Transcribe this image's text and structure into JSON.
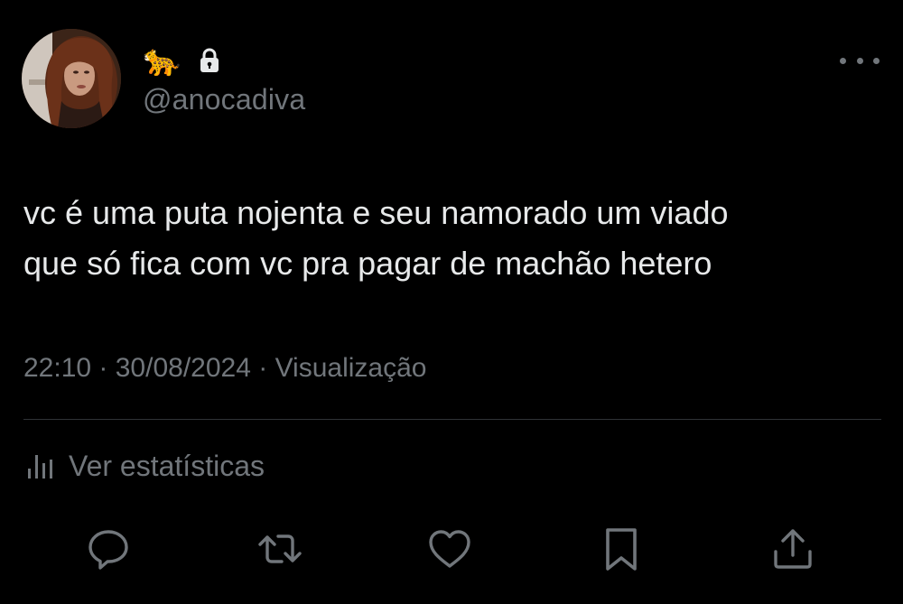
{
  "author": {
    "name_emoji": "🐆",
    "handle": "@anocadiva",
    "protected": true
  },
  "tweet": {
    "text": "vc é uma puta nojenta e seu namorado um viado\nque só fica com vc pra pagar de machão hetero",
    "time": "22:10",
    "date": "30/08/2024",
    "views_label": "Visualização",
    "separator": " · "
  },
  "stats": {
    "label": "Ver estatísticas"
  },
  "icons": {
    "more": "more-horizontal-icon",
    "lock": "lock-icon",
    "stats": "analytics-bars-icon",
    "reply": "reply-bubble-icon",
    "retweet": "retweet-icon",
    "like": "heart-icon",
    "bookmark": "bookmark-icon",
    "share": "share-upload-icon"
  },
  "colors": {
    "background": "#000000",
    "primary_text": "#e7e9ea",
    "secondary_text": "#71767b",
    "divider": "#2f3336"
  }
}
